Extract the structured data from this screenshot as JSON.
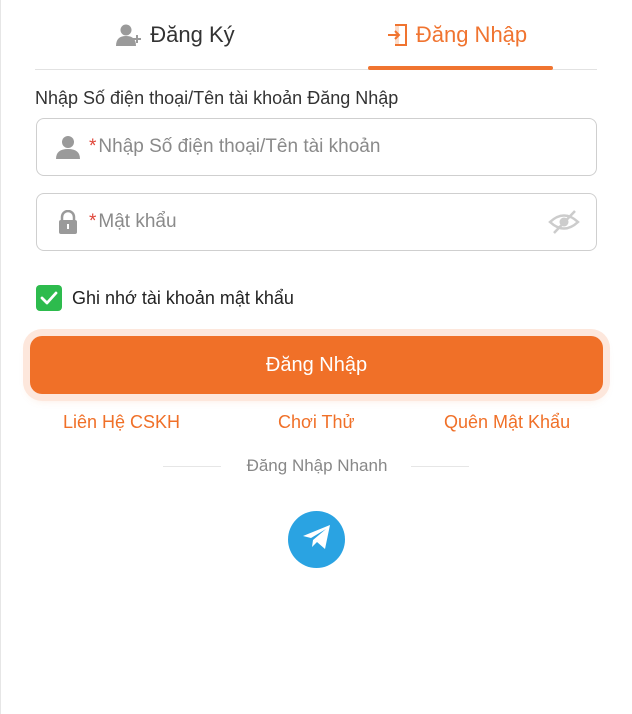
{
  "tabs": {
    "register": {
      "label": "Đăng Ký",
      "icon": "user-add-icon"
    },
    "login": {
      "label": "Đăng Nhập",
      "icon": "login-door-icon",
      "active": true
    }
  },
  "form": {
    "title": "Nhập Số điện thoại/Tên tài khoản Đăng Nhập",
    "username": {
      "required_mark": "*",
      "placeholder": "Nhập Số điện thoại/Tên tài khoản",
      "value": "",
      "icon": "user-icon"
    },
    "password": {
      "required_mark": "*",
      "placeholder": "Mật khẩu",
      "value": "",
      "icon": "lock-icon",
      "toggle_icon": "eye-hidden-icon"
    },
    "remember": {
      "label": "Ghi nhớ tài khoản mật khẩu",
      "checked": true
    },
    "submit_label": "Đăng Nhập"
  },
  "links": {
    "support": "Liên Hệ CSKH",
    "trial": "Chơi Thử",
    "forgot": "Quên Mật Khẩu"
  },
  "quick_login": {
    "label": "Đăng Nhập Nhanh",
    "providers": [
      "telegram-icon"
    ]
  },
  "colors": {
    "accent": "#f07028",
    "check": "#2dbb4d",
    "telegram": "#2aa3e2",
    "required": "#e0463a"
  }
}
